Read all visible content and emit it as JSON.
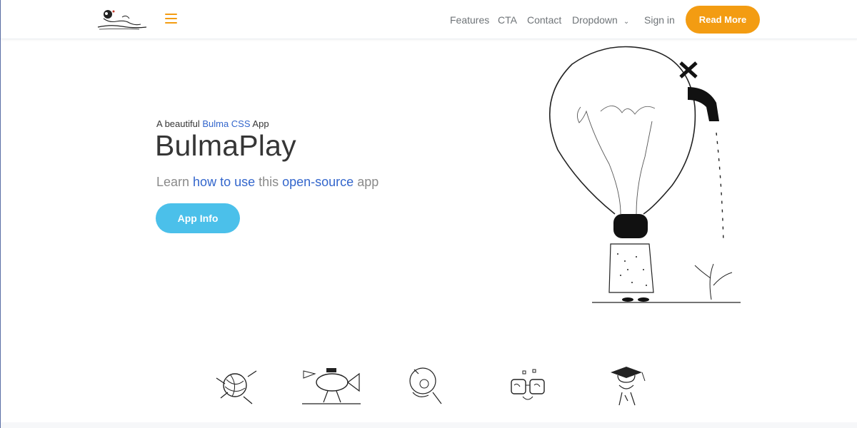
{
  "nav": {
    "items": [
      {
        "label": "Features"
      },
      {
        "label": "CTA"
      },
      {
        "label": "Contact"
      },
      {
        "label": "Dropdown"
      },
      {
        "label": "Sign in"
      }
    ],
    "cta_label": "Read More"
  },
  "hero": {
    "kicker_pre": "A beautiful ",
    "kicker_link": "Bulma CSS",
    "kicker_post": " App",
    "title": "BulmaPlay",
    "desc_1": "Learn ",
    "desc_link_1": "how to use",
    "desc_2": " this ",
    "desc_link_2": "open-source",
    "desc_3": " app",
    "button_label": "App Info"
  },
  "colors": {
    "accent_orange": "#f39c12",
    "button_blue": "#4bc0ea",
    "link_blue": "#3366cc",
    "title_dark": "#363636",
    "muted": "#8a8a8a"
  },
  "icons": [
    "logo-illustration",
    "hamburger-icon",
    "chevron-down-icon",
    "lightbulb-faucet-illustration",
    "yarn-ball-illustration",
    "fish-walker-illustration",
    "guitar-player-illustration",
    "glasses-illustration",
    "graduate-illustration"
  ]
}
